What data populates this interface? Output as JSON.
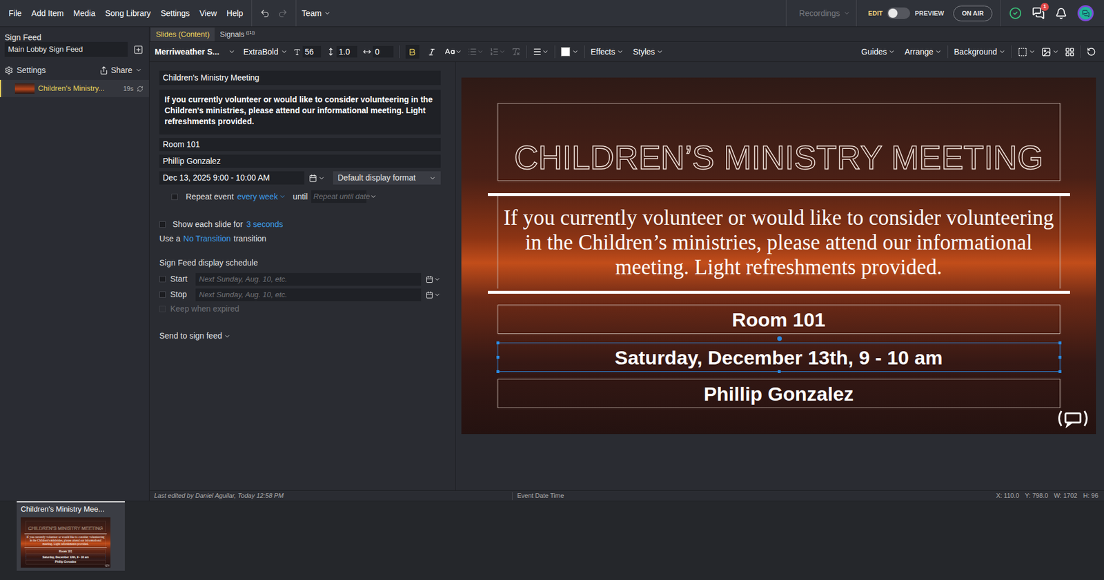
{
  "menu": [
    "File",
    "Add Item",
    "Media",
    "Song Library",
    "Settings",
    "View",
    "Help"
  ],
  "team": "Team",
  "recordings": "Recordings",
  "mode": {
    "edit": "EDIT",
    "preview": "PREVIEW",
    "preview_on": false
  },
  "on_air": "ON AIR",
  "chat_badge": "1",
  "sidebar": {
    "title": "Sign Feed",
    "feed_name": "Main Lobby Sign Feed",
    "settings": "Settings",
    "share": "Share",
    "items": [
      {
        "label": "Children's Ministry...",
        "duration": "19s",
        "selected": true
      }
    ]
  },
  "tabs": [
    {
      "label": "Slides (Content)",
      "badge": "",
      "selected": true
    },
    {
      "label": "Signals",
      "badge": "((1))",
      "selected": false
    }
  ],
  "toolbar": {
    "font": "Merriweather S...",
    "weight": "ExtraBold",
    "size": "56",
    "line_height": "1.0",
    "spacing": "0",
    "bold": true,
    "italic": false,
    "fill_color": "#ffffff",
    "effects": "Effects",
    "styles": "Styles",
    "guides": "Guides",
    "arrange": "Arrange",
    "background": "Background"
  },
  "form": {
    "title": "Children's Ministry Meeting",
    "description": "If you currently volunteer or would like to consider volunteering in the Children's ministries, please attend our informational meeting. Light refreshments provided.",
    "room": "Room 101",
    "host": "Phillip Gonzalez",
    "date": "Dec 13, 2025 9:00 - 10:00 AM",
    "date_format": "Default display format",
    "repeat": {
      "label": "Repeat event",
      "checked": false,
      "frequency": "every week",
      "until": "until",
      "until_placeholder": "Repeat until date"
    },
    "slide_time": {
      "prefix": "Show each slide for",
      "value": "3 seconds",
      "checked": false
    },
    "transition": {
      "prefix": "Use a",
      "value": "No Transition",
      "suffix": "transition"
    },
    "schedule": {
      "title": "Sign Feed display schedule",
      "rows": [
        {
          "label": "Start",
          "checked": false,
          "placeholder": "Next Sunday, Aug. 10, etc."
        },
        {
          "label": "Stop",
          "checked": false,
          "placeholder": "Next Sunday, Aug. 10, etc."
        }
      ],
      "keep": {
        "label": "Keep when expired",
        "checked": false,
        "disabled": true
      }
    },
    "send": "Send to sign feed"
  },
  "canvas": {
    "title": "CHILDREN’S MINISTRY MEETING",
    "body": "If you currently volunteer or would like to consider volunteering in the Children’s ministries, please attend our informational meeting. Light refreshments provided.",
    "lines": [
      {
        "text": "Room 101",
        "selected": false
      },
      {
        "text": "Saturday, December 13th, 9 - 10 am",
        "selected": true
      },
      {
        "text": "Phillip Gonzalez",
        "selected": false
      }
    ]
  },
  "status_bar": {
    "edited": "Last edited by Daniel Aguilar, Today 12:58 PM",
    "element": "Event Date Time",
    "coords": [
      "X: 110.0",
      "Y: 798.0",
      "W: 1702",
      "H: 96"
    ]
  },
  "slides": [
    {
      "label": "Children's Ministry Mee...",
      "selected": true
    }
  ]
}
